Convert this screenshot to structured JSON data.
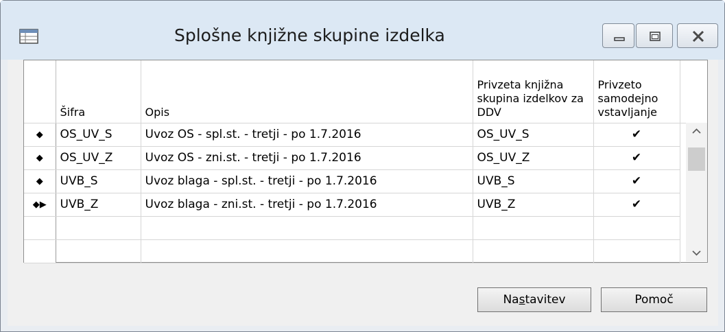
{
  "window": {
    "title": "Splošne knjižne skupine izdelka",
    "icon": "table-icon",
    "controls": [
      "minimize-icon",
      "maximize-icon",
      "close-icon"
    ]
  },
  "grid": {
    "columns": {
      "code": "Šifra",
      "description": "Opis",
      "vat_group": "Privzeta knjižna skupina izdelkov za DDV",
      "auto_insert": "Privzeto samodejno vstavljanje"
    },
    "rows": [
      {
        "selector": "◆",
        "code": "OS_UV_S",
        "description": "Uvoz OS - spl.st. - tretji - po 1.7.2016",
        "vat_group": "OS_UV_S",
        "auto_insert": "✔"
      },
      {
        "selector": "◆",
        "code": "OS_UV_Z",
        "description": "Uvoz OS - zni.st. - tretji - po 1.7.2016",
        "vat_group": "OS_UV_Z",
        "auto_insert": "✔"
      },
      {
        "selector": "◆",
        "code": "UVB_S",
        "description": "Uvoz blaga - spl.st. - tretji - po 1.7.2016",
        "vat_group": "UVB_S",
        "auto_insert": "✔"
      },
      {
        "selector": "◆▶",
        "code": "UVB_Z",
        "description": "Uvoz blaga - zni.st. - tretji - po 1.7.2016",
        "vat_group": "UVB_Z",
        "auto_insert": "✔"
      },
      {
        "selector": "",
        "code": "",
        "description": "",
        "vat_group": "",
        "auto_insert": ""
      },
      {
        "selector": "",
        "code": "",
        "description": "",
        "vat_group": "",
        "auto_insert": ""
      }
    ]
  },
  "buttons": {
    "settings_pre": "Na",
    "settings_underline": "s",
    "settings_post": "tavitev",
    "help": "Pomoč"
  }
}
